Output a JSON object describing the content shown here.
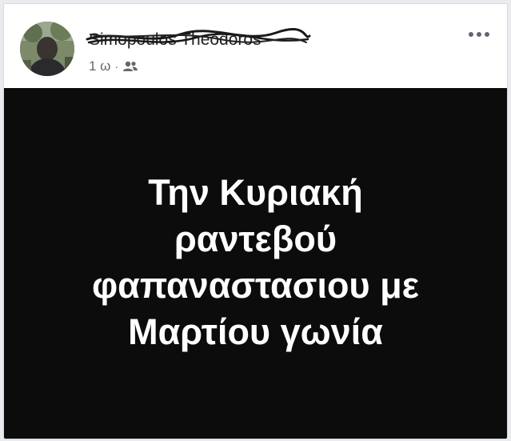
{
  "post": {
    "author_name": "Simopoulos Theodoros",
    "timestamp": "1 ω",
    "separator": "·",
    "audience_icon": "friends-icon",
    "more_icon": "more-options-icon",
    "image_text_lines": [
      "Την Κυριακή",
      "ραντεβού",
      "φαπαναστασιου με",
      "Μαρτίου γωνία"
    ],
    "colors": {
      "image_background": "#0c0c0c",
      "image_text": "#ffffff",
      "meta_text": "#65676b",
      "name_text": "#1c1e21"
    }
  }
}
